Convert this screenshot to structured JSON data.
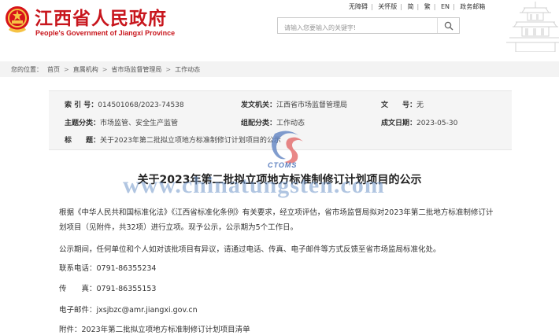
{
  "header": {
    "title": "江西省人民政府",
    "subtitle": "People's Government of Jiangxi Province",
    "top_links": [
      "无障碍",
      "关怀版",
      "简",
      "繁",
      "EN",
      "政务邮箱"
    ],
    "search_placeholder": "请输入您要输入的关键字!"
  },
  "breadcrumb": {
    "label": "您的位置：",
    "items": [
      "首页",
      "直属机构",
      "省市场监督管理局",
      "工作动态"
    ]
  },
  "info": {
    "index_label": "索 引 号：",
    "index_value": "014501068/2023-74538",
    "issuer_label": "发文机关：",
    "issuer_value": "江西省市场监督管理局",
    "docno_label": "文　　号：",
    "docno_value": "无",
    "topic_label": "主题分类：",
    "topic_value": "市场监管、安全生产监管",
    "genre_label": "组配分类：",
    "genre_value": "工作动态",
    "date_label": "成文日期：",
    "date_value": "2023-05-30",
    "subject_label": "标　　题：",
    "subject_value": "关于2023年第二批拟立项地方标准制修订计划项目的公示"
  },
  "watermark": {
    "logo_text": "CTOMS",
    "url": "www.chinatungsten.com"
  },
  "article": {
    "title": "关于2023年第二批拟立项地方标准制修订计划项目的公示",
    "para1_line1": "根据《中华人民共和国标准化法》《江西省标准化条例》有关要求，经立项评估，省市场监督局拟对2023年第二批地方标准制修订计",
    "para1_line2": "划项目（见附件，共32项）进行立项。现予公示，公示期为5个工作日。",
    "para2": "公示期间，任何单位和个人如对该批项目有异议，请通过电话、传真、电子邮件等方式反馈至省市场监局标准化处。",
    "tel": "联系电话：0791-86355234",
    "fax": "传　　真：0791-86355153",
    "email": "电子邮件：jxsjbzc@amr.jiangxi.gov.cn",
    "attachment": "附件：2023年第二批拟立项地方标准制修订计划项目清单"
  },
  "colors": {
    "brand_red": "#c8161d",
    "watermark_blue": "#7095c9"
  }
}
